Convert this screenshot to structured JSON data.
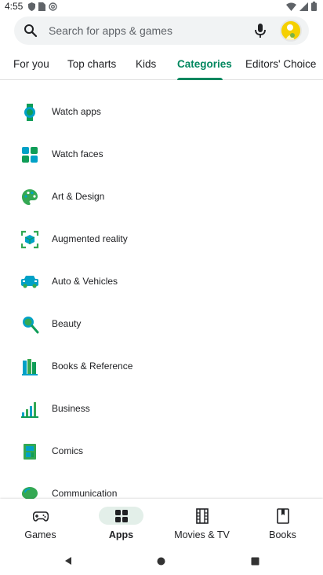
{
  "status_bar": {
    "time": "4:55"
  },
  "search": {
    "placeholder": "Search for apps & games"
  },
  "tabs": [
    {
      "label": "For you",
      "active": false
    },
    {
      "label": "Top charts",
      "active": false
    },
    {
      "label": "Kids",
      "active": false
    },
    {
      "label": "Categories",
      "active": true
    },
    {
      "label": "Editors' Choice",
      "active": false
    }
  ],
  "categories": [
    {
      "label": "Watch apps",
      "icon": "watch-icon",
      "color": "#0f9d58"
    },
    {
      "label": "Watch faces",
      "icon": "watch-faces-icon",
      "color": "#00a1c7"
    },
    {
      "label": "Art & Design",
      "icon": "palette-icon",
      "color": "#34a853"
    },
    {
      "label": "Augmented reality",
      "icon": "ar-cube-icon",
      "color": "#00a1c7"
    },
    {
      "label": "Auto & Vehicles",
      "icon": "car-icon",
      "color": "#00a1c7"
    },
    {
      "label": "Beauty",
      "icon": "mirror-icon",
      "color": "#34a853"
    },
    {
      "label": "Books & Reference",
      "icon": "books-icon",
      "color": "#34a853"
    },
    {
      "label": "Business",
      "icon": "bar-chart-icon",
      "color": "#00a1c7"
    },
    {
      "label": "Comics",
      "icon": "comic-icon",
      "color": "#34a853"
    },
    {
      "label": "Communication",
      "icon": "chat-bubble-icon",
      "color": "#34a853"
    }
  ],
  "bottom_nav": [
    {
      "label": "Games",
      "icon": "gamepad-icon",
      "active": false
    },
    {
      "label": "Apps",
      "icon": "apps-grid-icon",
      "active": true
    },
    {
      "label": "Movies & TV",
      "icon": "film-icon",
      "active": false
    },
    {
      "label": "Books",
      "icon": "bookmark-icon",
      "active": false
    }
  ],
  "colors": {
    "accent": "#01875f",
    "search_bg": "#f1f3f4",
    "active_pill": "#e3efe9"
  }
}
